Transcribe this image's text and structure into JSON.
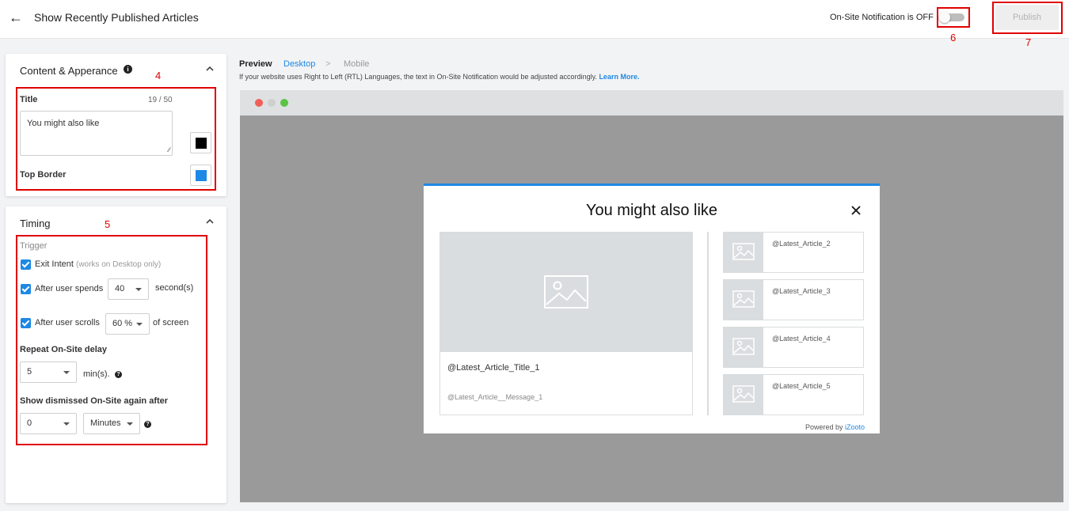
{
  "header": {
    "title": "Show Recently Published Articles",
    "notification_label": "On-Site Notification is OFF",
    "notification_on": false,
    "publish_label": "Publish"
  },
  "annotations": [
    "4",
    "5",
    "6",
    "7"
  ],
  "content_card": {
    "heading": "Content & Apperance",
    "title_label": "Title",
    "title_counter": "19 / 50",
    "title_value": "You might also like",
    "title_color": "#000000",
    "top_border_label": "Top Border",
    "top_border_color": "#1e88e5"
  },
  "timing_card": {
    "heading": "Timing",
    "trigger_label": "Trigger",
    "exit_intent_label": "Exit Intent",
    "exit_intent_note": "(works on Desktop only)",
    "after_spends_label": "After user spends",
    "after_spends_value": "40",
    "after_spends_unit": "second(s)",
    "after_scrolls_label": "After user scrolls",
    "after_scrolls_value": "60 %",
    "after_scrolls_unit": "of screen",
    "repeat_label": "Repeat On-Site delay",
    "repeat_value": "5",
    "repeat_unit": "min(s).",
    "dismissed_label": "Show dismissed On-Site again after",
    "dismissed_value": "0",
    "dismissed_unit": "Minutes"
  },
  "preview": {
    "tab_preview": "Preview",
    "tab_desktop": "Desktop",
    "tab_separator": ">",
    "tab_mobile": "Mobile",
    "rtl_note": "If your website uses Right to Left (RTL) Languages, the text in On-Site Notification would be adjusted accordingly.",
    "learn_more": "Learn More."
  },
  "popup": {
    "title": "You might also like",
    "main_title": "@Latest_Article_Title_1",
    "main_message": "@Latest_Article__Message_1",
    "side_articles": [
      "@Latest_Article_2",
      "@Latest_Article_3",
      "@Latest_Article_4",
      "@Latest_Article_5"
    ],
    "powered_by": "Powered by",
    "brand": "iZooto"
  }
}
